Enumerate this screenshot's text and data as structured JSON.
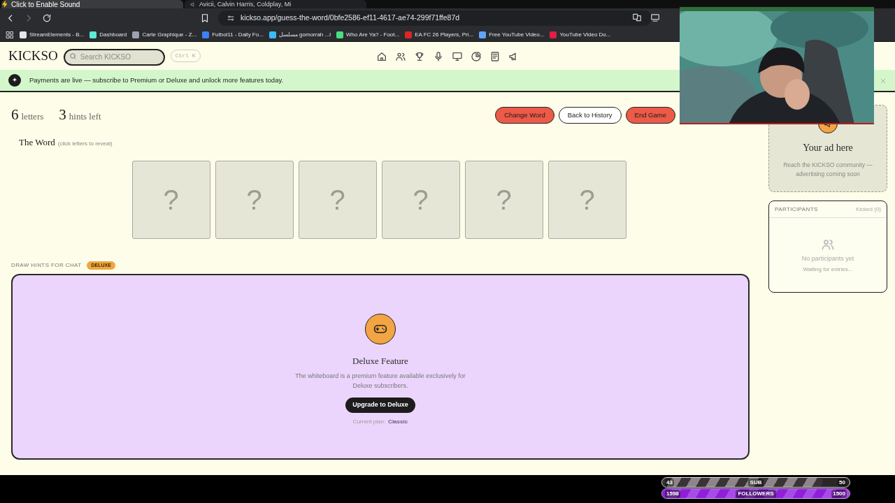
{
  "browser": {
    "sound_prompt": "Click to Enable Sound",
    "tabs": [
      {
        "selected": true
      },
      {
        "title": "Avicii, Calvin Harris, Coldplay, Mi",
        "selected": false
      }
    ],
    "url": "kickso.app/guess-the-word/0bfe2586-ef11-4617-ae74-299f71ffe87d",
    "bookmarks": [
      {
        "title": "StreamElements - B...",
        "color": "#e5e7eb"
      },
      {
        "title": "Dashboard",
        "color": "#5eead4"
      },
      {
        "title": "Carte Graphique - Z...",
        "color": "#9ca3af"
      },
      {
        "title": "Futbol11 - Daily Fo...",
        "color": "#3b82f6"
      },
      {
        "title": "مسلسل gomorrah ...l",
        "color": "#38bdf8"
      },
      {
        "title": "Who Are Ya? - Foot...",
        "color": "#4ade80"
      },
      {
        "title": "EA FC 26 Players, Pri...",
        "color": "#dc2626"
      },
      {
        "title": "Free YouTube Video...",
        "color": "#60a5fa"
      },
      {
        "title": "YouTube Video Do...",
        "color": "#e11d48"
      }
    ]
  },
  "header": {
    "logo": "KICKSO",
    "search": {
      "placeholder": "Search KICKSO"
    },
    "shortcut": "Ctrl K"
  },
  "banner": {
    "text": "Payments are live — subscribe to Premium or Deluxe and unlock more features today."
  },
  "stats": [
    {
      "count": "6",
      "unit": "letters"
    },
    {
      "count": "3",
      "unit": "hints left"
    }
  ],
  "actions": [
    {
      "label": "Change Word",
      "kind": "danger"
    },
    {
      "label": "Back to History",
      "kind": "outline"
    },
    {
      "label": "End Game",
      "kind": "danger"
    }
  ],
  "word": {
    "title": "The Word",
    "hint": "(click letters to reveal)",
    "tiles": [
      "?",
      "?",
      "?",
      "?",
      "?",
      "?"
    ]
  },
  "hints": {
    "label": "DRAW HINTS FOR CHAT",
    "badge": "DELUXE",
    "title": "Deluxe Feature",
    "text": "The whiteboard is a premium feature available exclusively for Deluxe subscribers.",
    "button": "Upgrade to Deluxe",
    "plan_label": "Current plan:",
    "plan": "Classic"
  },
  "ad": {
    "title": "Your ad here",
    "text": "Reach the KICKSO community — advertising coming soon"
  },
  "participants": {
    "title": "PARTICIPANTS",
    "kicked": "Kicked (0)",
    "empty": "No participants yet",
    "sub": "Waiting for entries..."
  },
  "stream_bars": [
    {
      "kind": "sub",
      "label": "SUB",
      "start": "43",
      "end": "50",
      "level": 0.86
    },
    {
      "kind": "followers",
      "label": "FOLLOWERS",
      "start": "1598",
      "end": "1500",
      "level": 1
    }
  ]
}
